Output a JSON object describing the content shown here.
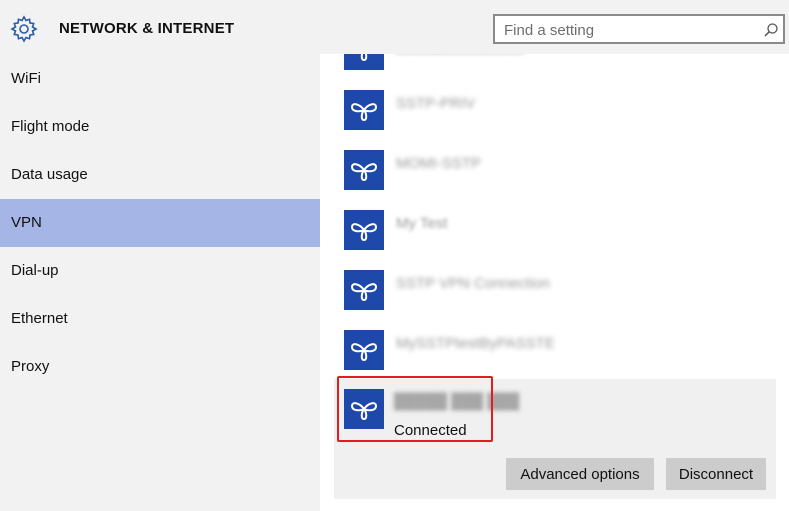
{
  "header": {
    "title": "NETWORK & INTERNET",
    "search_placeholder": "Find a setting",
    "settings_icon": "gear-icon",
    "search_icon": "search-icon"
  },
  "sidebar": {
    "items": [
      {
        "label": "WiFi",
        "selected": false
      },
      {
        "label": "Flight mode",
        "selected": false
      },
      {
        "label": "Data usage",
        "selected": false
      },
      {
        "label": "VPN",
        "selected": true
      },
      {
        "label": "Dial-up",
        "selected": false
      },
      {
        "label": "Ethernet",
        "selected": false
      },
      {
        "label": "Proxy",
        "selected": false
      }
    ]
  },
  "vpn": {
    "connections": [
      {
        "name": "████████████",
        "icon": "vpn-icon"
      },
      {
        "name": "SSTP-PRIV",
        "icon": "vpn-icon"
      },
      {
        "name": "MOMI-SSTP",
        "icon": "vpn-icon"
      },
      {
        "name": "My Test",
        "icon": "vpn-icon"
      },
      {
        "name": "SSTP VPN Connection",
        "icon": "vpn-icon"
      },
      {
        "name": "MySSTPtestByPASSTE",
        "icon": "vpn-icon"
      }
    ],
    "selected": {
      "name": "█████ ███ ███",
      "status": "Connected",
      "advanced_label": "Advanced options",
      "disconnect_label": "Disconnect"
    }
  },
  "colors": {
    "accent_selected": "#a5b5e6",
    "vpn_icon_bg": "#1f48ab",
    "highlight_border": "#e31b23",
    "button_bg": "#cccccc"
  }
}
